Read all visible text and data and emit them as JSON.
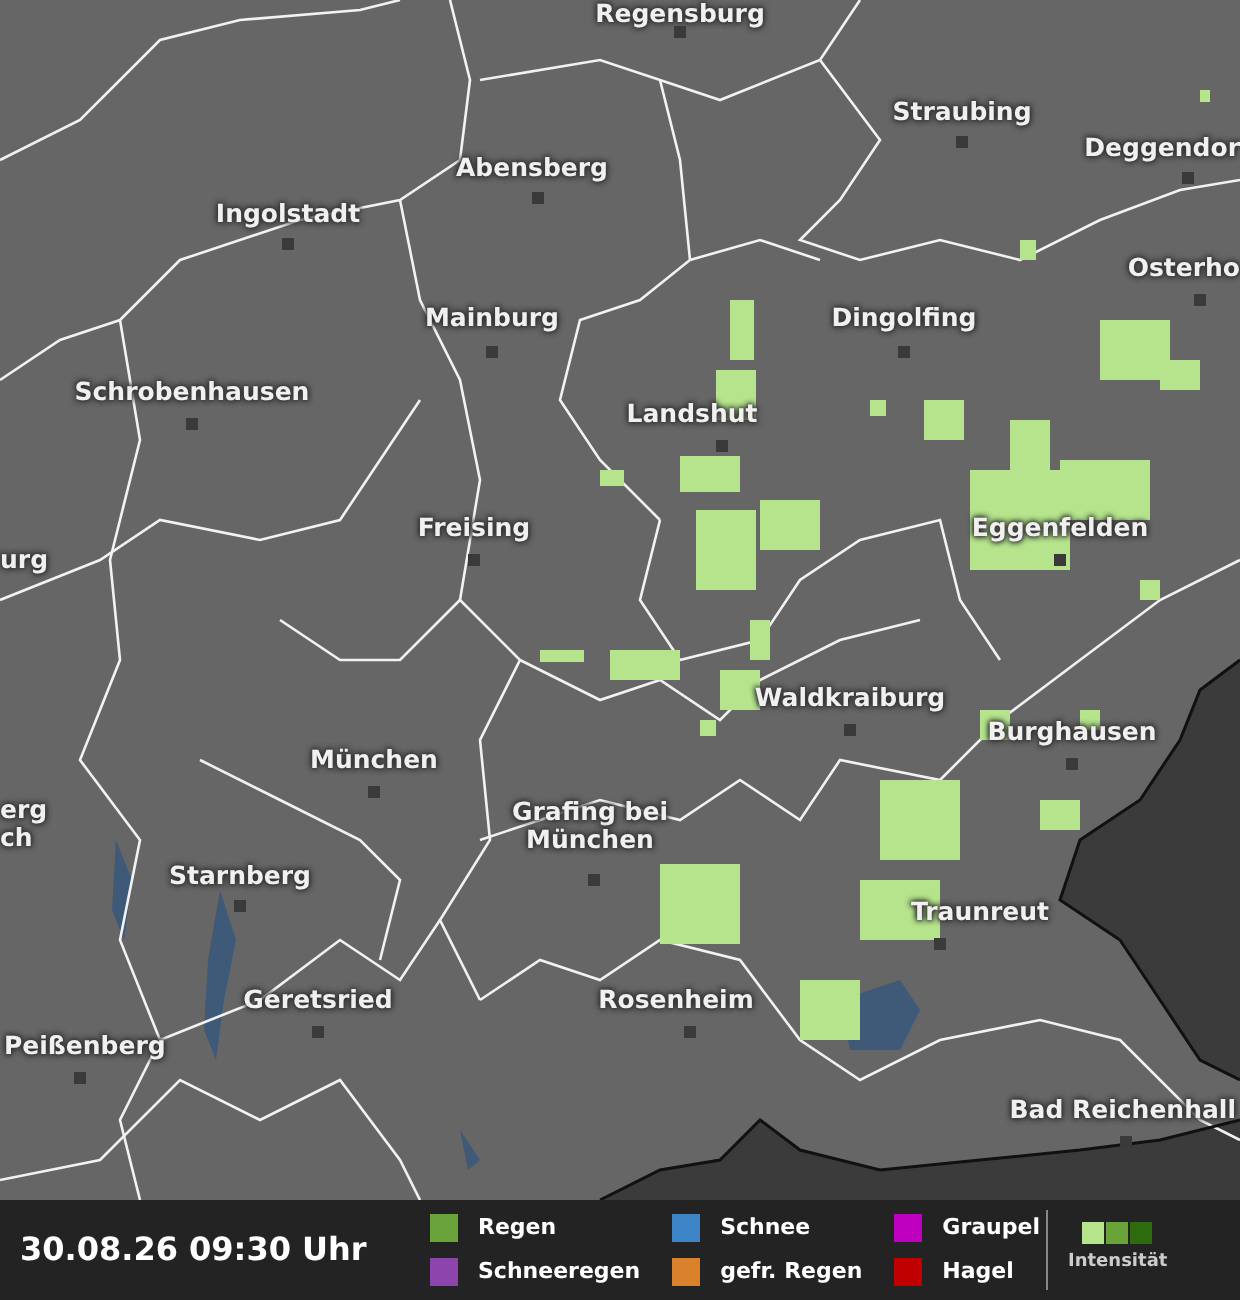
{
  "map": {
    "cities": [
      {
        "name": "Regensburg"
      },
      {
        "name": "Straubing"
      },
      {
        "name": "Deggendor"
      },
      {
        "name": "Osterho"
      },
      {
        "name": "Abensberg"
      },
      {
        "name": "Ingolstadt"
      },
      {
        "name": "Mainburg"
      },
      {
        "name": "Dingolfing"
      },
      {
        "name": "Schrobenhausen"
      },
      {
        "name": "Landshut"
      },
      {
        "name": "Freising"
      },
      {
        "name": "Eggenfelden"
      },
      {
        "name": "urg"
      },
      {
        "name": "Waldkraiburg"
      },
      {
        "name": "München"
      },
      {
        "name": "Burghausen"
      },
      {
        "name": "erg\nch"
      },
      {
        "name": "Starnberg"
      },
      {
        "name": "Grafing bei\nMünchen"
      },
      {
        "name": "Traunreut"
      },
      {
        "name": "Geretsried"
      },
      {
        "name": "Rosenheim"
      },
      {
        "name": "Peißenberg"
      },
      {
        "name": "Bad Reichenhall"
      }
    ]
  },
  "footer": {
    "timestamp": "30.08.26 09:30 Uhr",
    "legend": [
      {
        "label": "Regen",
        "color": "#6aa33a"
      },
      {
        "label": "Schneeregen",
        "color": "#8e44ad"
      },
      {
        "label": "Schnee",
        "color": "#3d85c6"
      },
      {
        "label": "gefr. Regen",
        "color": "#d9822b"
      },
      {
        "label": "Graupel",
        "color": "#c000c0"
      },
      {
        "label": "Hagel",
        "color": "#c00000"
      }
    ],
    "intensity": {
      "label": "Intensität",
      "steps": [
        {
          "color": "#b5e48c"
        },
        {
          "color": "#6aa33a"
        },
        {
          "color": "#2e6b0f"
        }
      ]
    }
  }
}
